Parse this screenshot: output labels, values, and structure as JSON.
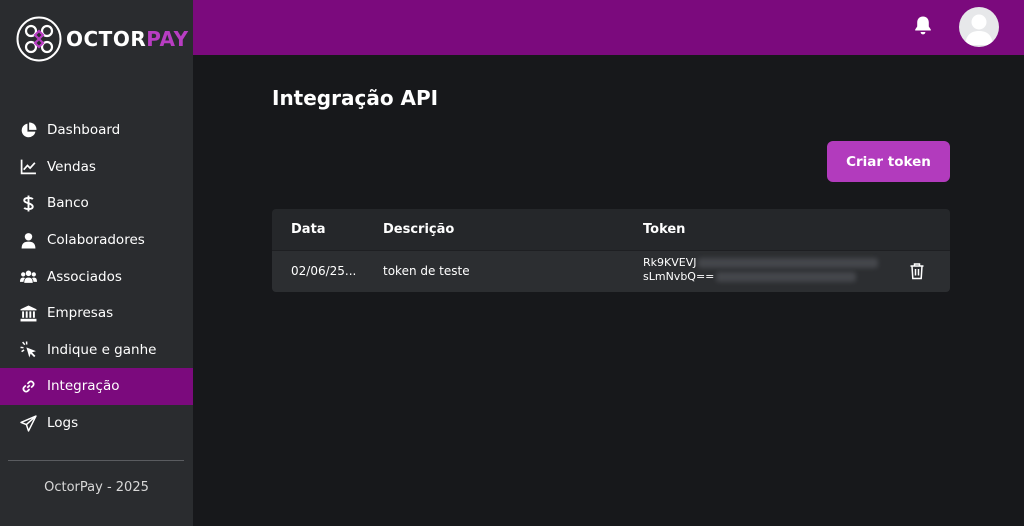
{
  "brand": {
    "name_part1": "OCTOR",
    "name_part2": "PAY"
  },
  "sidebar": {
    "items": [
      {
        "label": "Dashboard",
        "icon": "pie-chart-icon"
      },
      {
        "label": "Vendas",
        "icon": "line-chart-icon"
      },
      {
        "label": "Banco",
        "icon": "dollar-icon"
      },
      {
        "label": "Colaboradores",
        "icon": "user-icon"
      },
      {
        "label": "Associados",
        "icon": "users-icon"
      },
      {
        "label": "Empresas",
        "icon": "bank-icon"
      },
      {
        "label": "Indique e ganhe",
        "icon": "pointer-click-icon"
      },
      {
        "label": "Integração",
        "icon": "link-icon",
        "active": true
      },
      {
        "label": "Logs",
        "icon": "paper-plane-icon"
      }
    ],
    "footer": "OctorPay - 2025"
  },
  "page": {
    "title": "Integração API",
    "create_button": "Criar token"
  },
  "table": {
    "headers": {
      "date": "Data",
      "description": "Descrição",
      "token": "Token"
    },
    "rows": [
      {
        "date": "02/06/25...",
        "description": "token de teste",
        "token_line1": "Rk9KVEVJ",
        "token_line2": "sLmNvbQ=="
      }
    ]
  },
  "colors": {
    "accent": "#7b0a7d",
    "button": "#b23bbd",
    "sidebar": "#2a2c2f",
    "background": "#17181b"
  }
}
